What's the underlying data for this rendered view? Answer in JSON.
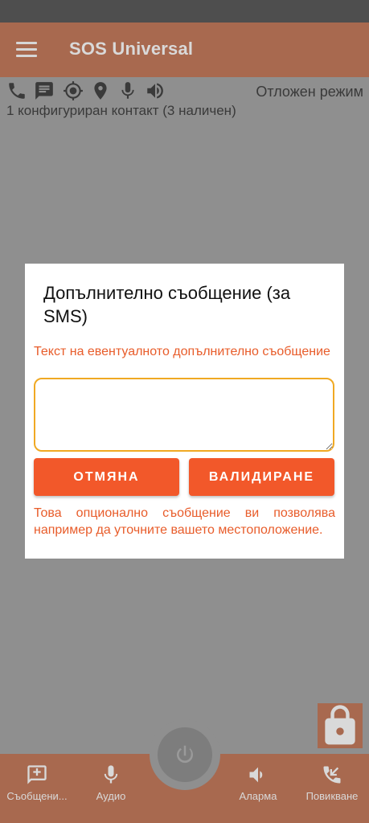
{
  "app": {
    "title": "SOS Universal"
  },
  "status": {
    "mode": "Отложен режим",
    "contacts": "1 конфигуриран контакт (3 наличен)",
    "icons": [
      "phone-icon",
      "message-icon",
      "gps-target-icon",
      "location-pin-icon",
      "microphone-icon",
      "speaker-icon"
    ]
  },
  "dialog": {
    "title": "Допълнително съобщение (за SMS)",
    "hint": "Текст на евентуалното допълнително съобщение",
    "input_value": "",
    "cancel_label": "ОТМЯНА",
    "validate_label": "ВАЛИДИРАНЕ",
    "note": "Това опционално съобщение ви позволява например да уточните вашето местоположение."
  },
  "bottom_nav": {
    "messages_label": "Съобщени...",
    "audio_label": "Аудио",
    "alarm_label": "Аларма",
    "call_label": "Повикване"
  },
  "colors": {
    "accent": "#f2582a",
    "accent_text": "#e85c2a",
    "input_border": "#f0a923",
    "appbar_dimmed": "#a8694f",
    "backdrop": "#8f8f8f"
  }
}
